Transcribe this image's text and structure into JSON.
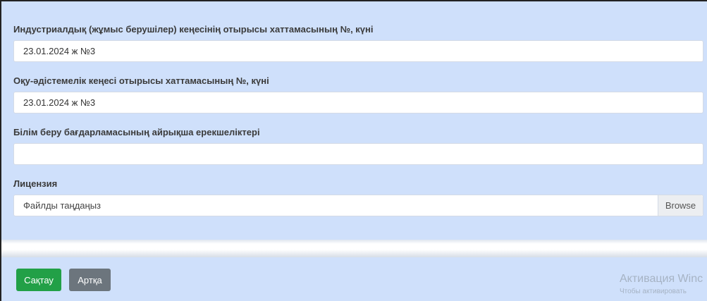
{
  "form": {
    "fields": [
      {
        "label": "Индустриалдық (жұмыс берушілер) кеңесінің отырысы хаттамасының №, күні",
        "value": "23.01.2024 ж №3"
      },
      {
        "label": "Оқу-әдістемелік кеңесі отырысы хаттамасының №, күні",
        "value": "23.01.2024 ж №3"
      },
      {
        "label": "Білім беру бағдарламасының айрықша ерекшеліктері",
        "value": ""
      }
    ],
    "license": {
      "label": "Лицензия",
      "placeholder": "Файлды таңдаңыз",
      "browse_label": "Browse"
    }
  },
  "footer": {
    "save_label": "Сақтау",
    "back_label": "Артқа"
  },
  "watermark": {
    "title": "Активация Winc",
    "subtitle": "Чтобы активировать"
  },
  "colors": {
    "panel_bg": "#cfe0fb",
    "save_button": "#22a047",
    "back_button": "#6c757d"
  }
}
